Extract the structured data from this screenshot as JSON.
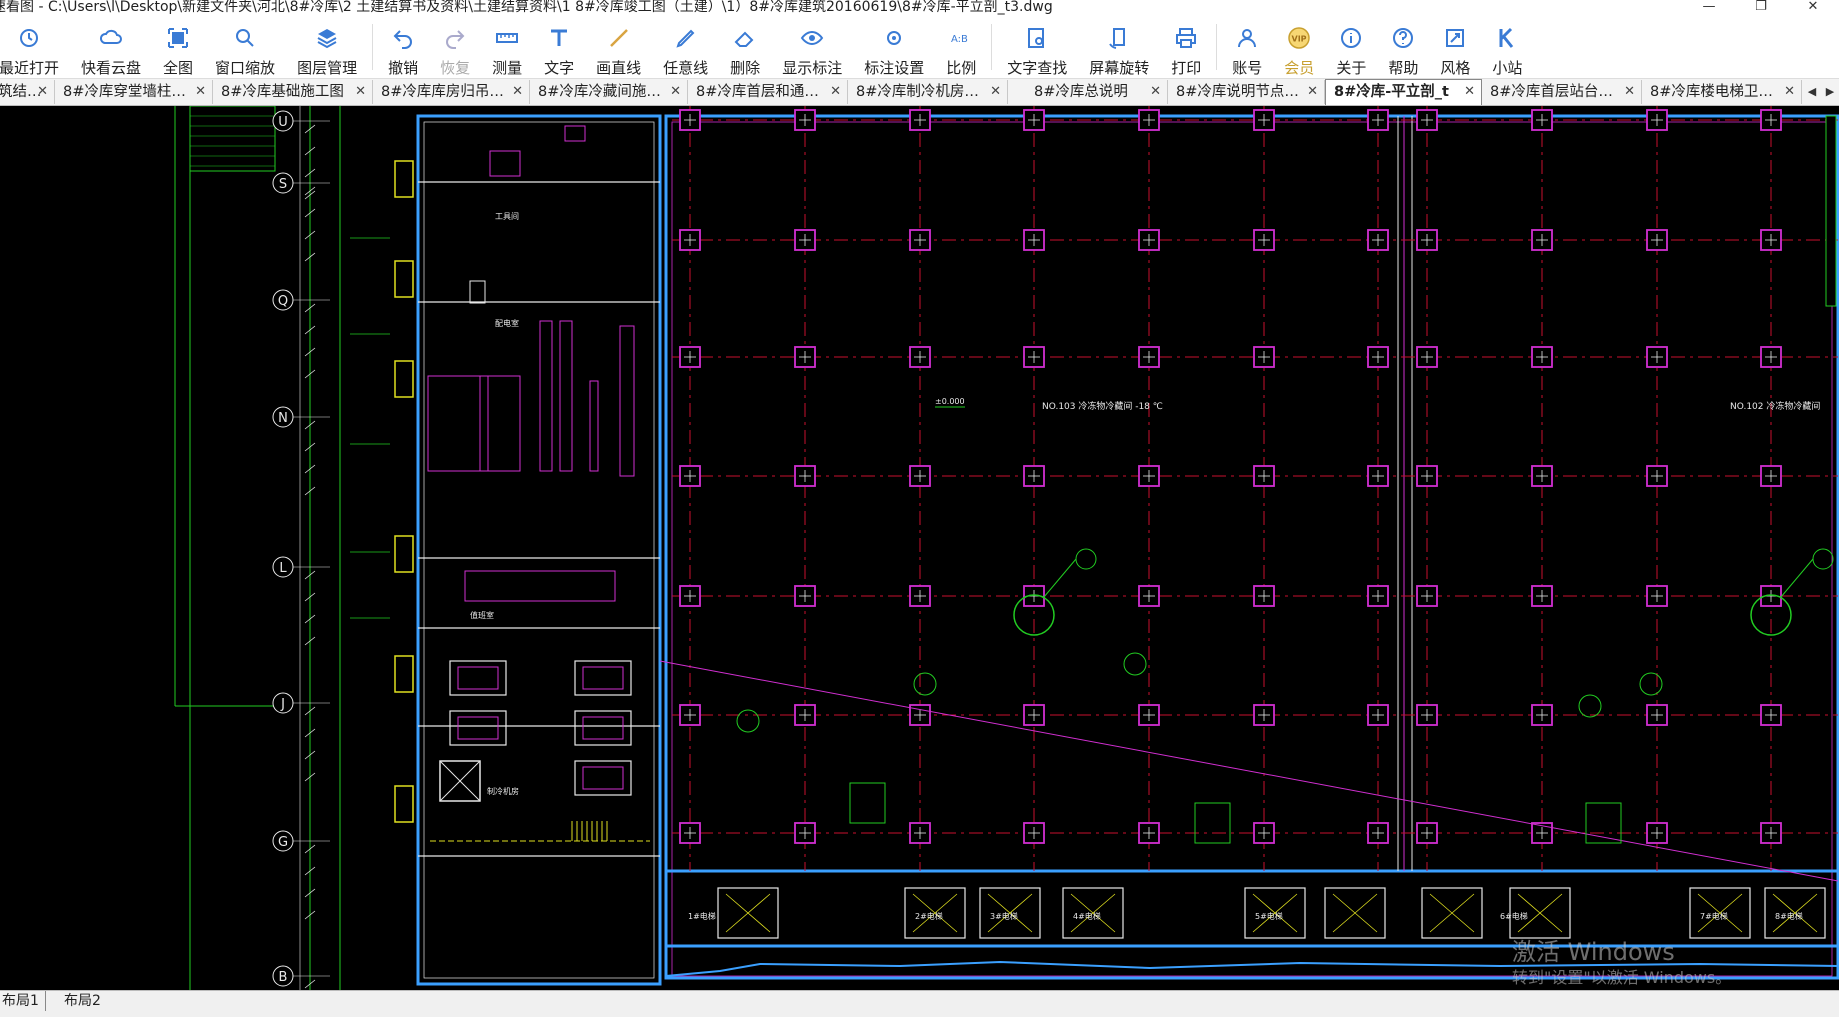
{
  "titlebar": {
    "title": "速看图 - C:\\Users\\l\\Desktop\\新建文件夹\\河北\\8#冷库\\2  土建结算书及资料\\土建结算资料\\1  8#冷库竣工图（土建）\\1）8#冷库建筑20160619\\8#冷库-平立剖_t3.dwg",
    "buttons": [
      "—",
      "❐",
      "✕"
    ]
  },
  "toolbar": {
    "items": [
      {
        "label": "最近打开",
        "icon": "clock-icon"
      },
      {
        "label": "快看云盘",
        "icon": "cloud-icon"
      },
      {
        "label": "全图",
        "icon": "fit-all-icon"
      },
      {
        "label": "窗口缩放",
        "icon": "window-zoom-icon"
      },
      {
        "label": "图层管理",
        "icon": "layers-icon"
      },
      {
        "label": "撤销",
        "icon": "undo-icon"
      },
      {
        "label": "恢复",
        "icon": "redo-icon"
      },
      {
        "label": "测量",
        "icon": "ruler-icon"
      },
      {
        "label": "文字",
        "icon": "text-icon"
      },
      {
        "label": "画直线",
        "icon": "line-icon"
      },
      {
        "label": "任意线",
        "icon": "pencil-icon"
      },
      {
        "label": "删除",
        "icon": "eraser-icon"
      },
      {
        "label": "显示标注",
        "icon": "eye-icon"
      },
      {
        "label": "标注设置",
        "icon": "annotation-settings-icon"
      },
      {
        "label": "比例",
        "icon": "scale-icon"
      },
      {
        "label": "文字查找",
        "icon": "text-search-icon"
      },
      {
        "label": "屏幕旋转",
        "icon": "rotate-screen-icon"
      },
      {
        "label": "打印",
        "icon": "printer-icon"
      },
      {
        "label": "账号",
        "icon": "user-icon"
      },
      {
        "label": "会员",
        "icon": "vip-icon"
      },
      {
        "label": "关于",
        "icon": "info-icon"
      },
      {
        "label": "帮助",
        "icon": "help-icon"
      },
      {
        "label": "风格",
        "icon": "style-icon"
      },
      {
        "label": "小站",
        "icon": "k-logo-icon"
      }
    ]
  },
  "tabs": [
    {
      "label": "筑结…"
    },
    {
      "label": "8#冷库穿堂墙柱…"
    },
    {
      "label": "8#冷库基础施工图"
    },
    {
      "label": "8#冷库库房归吊…"
    },
    {
      "label": "8#冷库冷藏间施…"
    },
    {
      "label": "8#冷库首层和通…"
    },
    {
      "label": "8#冷库制冷机房…"
    },
    {
      "label": "8#冷库总说明"
    },
    {
      "label": "8#冷库说明节点…"
    },
    {
      "label": "8#冷库-平立剖_t"
    },
    {
      "label": "8#冷库首层站台…"
    },
    {
      "label": "8#冷库楼电梯卫…"
    }
  ],
  "active_tab_index": 9,
  "tab_close": "✕",
  "tab_arrows": [
    "◀",
    "▶"
  ],
  "drawing": {
    "axis_labels": [
      "U",
      "S",
      "Q",
      "N",
      "L",
      "J",
      "G",
      "B"
    ],
    "room_labels": [
      "NO.103  冷冻物冷藏间  -18 ℃",
      "NO.102  冷冻物冷藏间"
    ],
    "elevation_label": "±0.000",
    "rooms_left": [
      "工具间",
      "配电室",
      "值班室",
      "制冷机房"
    ],
    "elevator_labels": [
      "1#电梯",
      "2#电梯",
      "3#电梯",
      "4#电梯",
      "5#电梯",
      "6#电梯",
      "7#电梯",
      "8#电梯"
    ],
    "colors": {
      "grid": "#c8102e",
      "column": "#d12fd1",
      "wall": "#3ba0ff",
      "annotation": "#22cc22",
      "dim": "#e8e8e8",
      "magenta_line": "#d12fd1"
    }
  },
  "watermark": {
    "line1": "激活 Windows",
    "line2": "转到\"设置\"以激活 Windows。"
  },
  "layout_tabs": [
    "布局1",
    "布局2"
  ]
}
